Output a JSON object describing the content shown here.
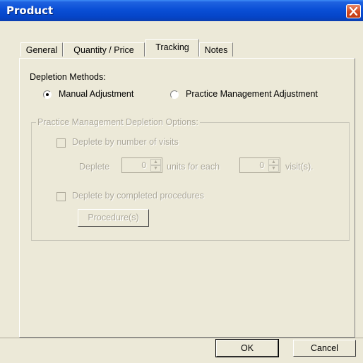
{
  "window": {
    "title": "Product"
  },
  "tabs": [
    {
      "label": "General",
      "active": false
    },
    {
      "label": "Quantity / Price",
      "active": false
    },
    {
      "label": "Tracking",
      "active": true
    },
    {
      "label": "Notes",
      "active": false
    }
  ],
  "depletion": {
    "heading": "Depletion Methods:",
    "manual_label": "Manual Adjustment",
    "manual_selected": true,
    "practice_label": "Practice Management Adjustment",
    "practice_selected": false
  },
  "options": {
    "group_title": "Practice Management Depletion Options:",
    "visits_check_label": "Deplete by number of visits",
    "deplete_label": "Deplete",
    "units_value": "0",
    "units_for_each_label": "units for each",
    "visits_value": "0",
    "visits_label": "visit(s).",
    "procedures_check_label": "Deplete by completed procedures",
    "procedures_button": "Procedure(s)"
  },
  "buttons": {
    "ok": "OK",
    "cancel": "Cancel"
  },
  "colors": {
    "titlebar": "#0a4fd6",
    "close": "#d2491f",
    "face": "#ece9d8",
    "disabled_text": "#aca899"
  },
  "icons": {
    "close": "close-icon",
    "spin": "spinner-arrows-icon"
  }
}
